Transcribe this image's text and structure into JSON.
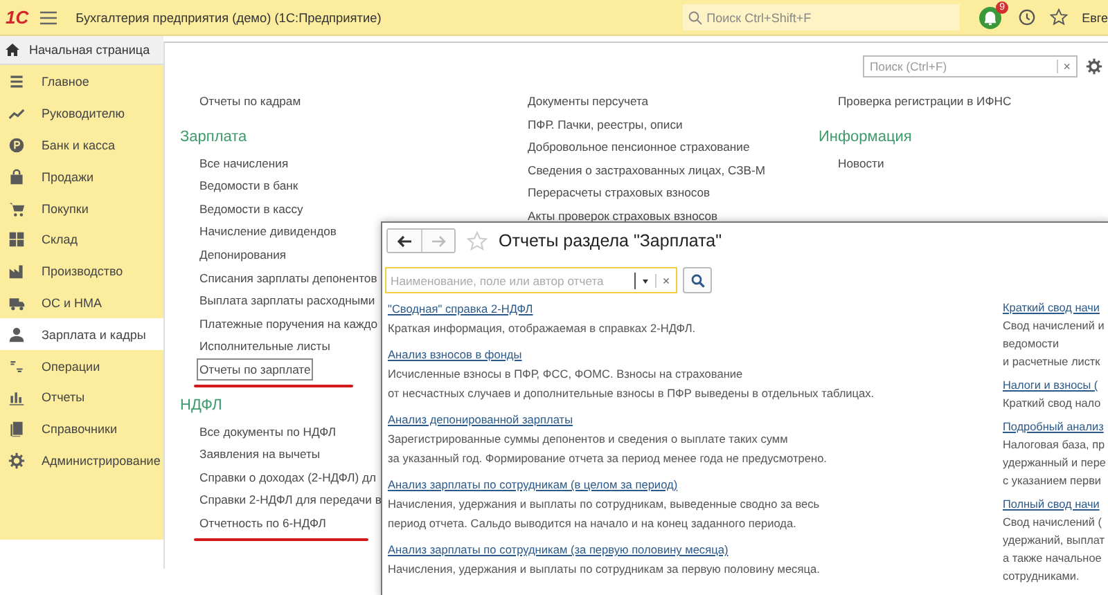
{
  "top_bar": {
    "logo": "1С",
    "title": "Бухгалтерия предприятия (демо)  (1С:Предприятие)",
    "search": {
      "placeholder": "Поиск Ctrl+Shift+F"
    },
    "notification_count": "9",
    "user": "Евге"
  },
  "home_tab": {
    "label": "Начальная страница"
  },
  "sidebar": {
    "items": [
      {
        "label": "Главное",
        "selected": false
      },
      {
        "label": "Руководителю",
        "selected": false
      },
      {
        "label": "Банк и касса",
        "selected": false
      },
      {
        "label": "Продажи",
        "selected": false
      },
      {
        "label": "Покупки",
        "selected": false
      },
      {
        "label": "Склад",
        "selected": false
      },
      {
        "label": "Производство",
        "selected": false
      },
      {
        "label": "ОС и НМА",
        "selected": false
      },
      {
        "label": "Зарплата и кадры",
        "selected": true
      },
      {
        "label": "Операции",
        "selected": false
      },
      {
        "label": "Отчеты",
        "selected": false
      },
      {
        "label": "Справочники",
        "selected": false
      },
      {
        "label": "Администрирование",
        "selected": false
      }
    ]
  },
  "section_panel": {
    "search": {
      "placeholder": "Поиск (Ctrl+F)",
      "clear": "×"
    },
    "columns": [
      [
        {
          "items": [
            {
              "text": "Отчеты по кадрам",
              "focused": false,
              "marked": false
            }
          ]
        },
        {
          "heading": "Зарплата",
          "items": [
            {
              "text": "Все начисления",
              "focused": false,
              "marked": false
            },
            {
              "text": "Ведомости в банк",
              "focused": false,
              "marked": false
            },
            {
              "text": "Ведомости в кассу",
              "focused": false,
              "marked": false
            },
            {
              "text": "Начисление дивидендов",
              "focused": false,
              "marked": false
            },
            {
              "text": "Депонирования",
              "focused": false,
              "marked": false
            },
            {
              "text": "Списания зарплаты депонентов",
              "focused": false,
              "marked": false
            },
            {
              "text": "Выплата зарплаты расходными",
              "focused": false,
              "marked": false
            },
            {
              "text": "Платежные поручения на каждо",
              "focused": false,
              "marked": false
            },
            {
              "text": "Исполнительные листы",
              "focused": false,
              "marked": false
            },
            {
              "text": "Отчеты по зарплате",
              "focused": true,
              "marked": true
            }
          ]
        },
        {
          "heading": "НДФЛ",
          "items": [
            {
              "text": "Все документы по НДФЛ",
              "focused": false,
              "marked": false
            },
            {
              "text": "Заявления на вычеты",
              "focused": false,
              "marked": false
            },
            {
              "text": "Справки о доходах (2-НДФЛ) дл",
              "focused": false,
              "marked": false
            },
            {
              "text": "Справки 2-НДФЛ для передачи в",
              "focused": false,
              "marked": false
            },
            {
              "text": "Отчетность по 6-НДФЛ",
              "focused": false,
              "marked": true
            }
          ]
        }
      ],
      [
        {
          "items": [
            {
              "text": "Документы персучета",
              "focused": false,
              "marked": false
            },
            {
              "text": "ПФР. Пачки, реестры, описи",
              "focused": false,
              "marked": false
            },
            {
              "text": "Добровольное пенсионное страхование",
              "focused": false,
              "marked": false
            },
            {
              "text": "Сведения о застрахованных лицах, СЗВ-М",
              "focused": false,
              "marked": false
            },
            {
              "text": "Перерасчеты страховых взносов",
              "focused": false,
              "marked": false
            },
            {
              "text": "Акты проверок страховых взносов",
              "focused": false,
              "marked": false
            }
          ]
        }
      ],
      [
        {
          "items": [
            {
              "text": "Проверка регистрации в ИФНС",
              "focused": false,
              "marked": false
            }
          ]
        },
        {
          "heading": "Информация",
          "items": [
            {
              "text": "Новости",
              "focused": false,
              "marked": false
            }
          ]
        }
      ]
    ]
  },
  "reports_window": {
    "title": "Отчеты раздела \"Зарплата\"",
    "search": {
      "placeholder": "Наименование, поле или автор отчета",
      "clear": "×"
    },
    "columns": [
      [
        {
          "link": "\"Сводная\" справка 2-НДФЛ",
          "description": "Краткая информация, отображаемая в справках 2-НДФЛ."
        },
        {
          "link": "Анализ взносов в фонды",
          "description": "Исчисленные взносы в ПФР, ФСС, ФОМС. Взносы на страхование\nот несчастных случаев и дополнительные взносы в ПФР выведены в отдельных таблицах."
        },
        {
          "link": "Анализ депонированной зарплаты",
          "description": "Зарегистрированные суммы депонентов и сведения о выплате таких сумм\nза указанный год. Формирование отчета за период менее года не предусмотрено."
        },
        {
          "link": "Анализ зарплаты по сотрудникам (в целом за период)",
          "description": "Начисления, удержания и выплаты по сотрудникам, выведенные сводно за весь\nпериод отчета. Сальдо выводится на начало и на конец заданного периода."
        },
        {
          "link": "Анализ зарплаты по сотрудникам (за первую половину месяца)",
          "description": "Начисления, удержания и выплаты по сотрудникам за первую половину месяца."
        }
      ],
      [
        {
          "link": "Краткий свод начи",
          "description": "Свод начислений и\nведомости\nи расчетные листк"
        },
        {
          "link": "Налоги и взносы (",
          "description": "Краткий свод нало"
        },
        {
          "link": "Подробный анализ",
          "description": "Налоговая база, пр\nудержанный и пере\nс указанием перви"
        },
        {
          "link": "Полный свод начи",
          "description": "Свод начислений (\nудержаний, выплат\nа также начальное\nсотрудниками."
        }
      ]
    ]
  }
}
